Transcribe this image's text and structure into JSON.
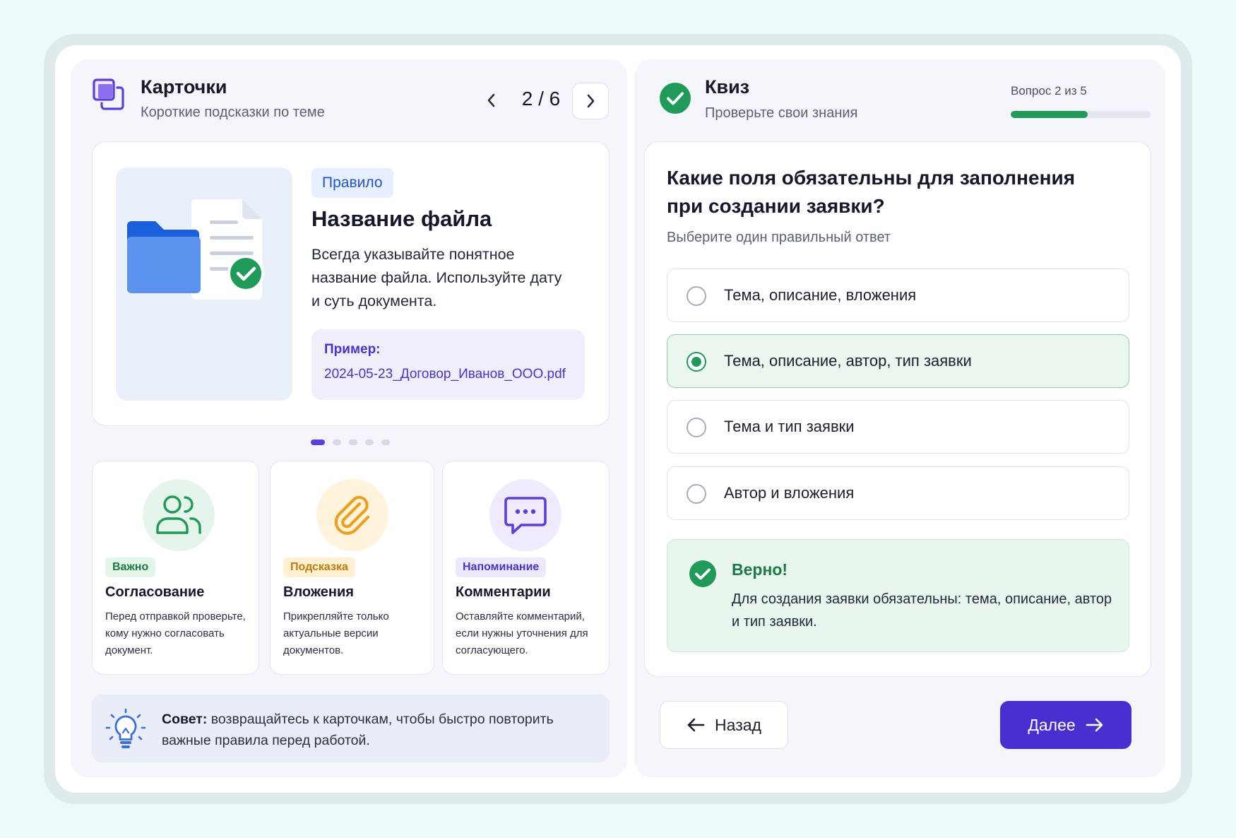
{
  "cards_panel": {
    "title": "Карточки",
    "subtitle": "Короткие подсказки по теме",
    "pager": "2 / 6"
  },
  "rule_card": {
    "badge": "Правило",
    "title": "Название файла",
    "text": "Всегда указывайте понятное название файла. Используйте дату и суть документа.",
    "example_label": "Пример:",
    "example_value": "2024-05-23_Договор_Иванов_ООО.pdf",
    "dots_total": 5,
    "dots_active": 1
  },
  "small_cards": [
    {
      "tag": "Важно",
      "title": "Согласование",
      "text": "Перед отправкой проверьте, кому нужно согласовать документ.",
      "icon": "users-icon"
    },
    {
      "tag": "Подсказка",
      "title": "Вложения",
      "text": "Прикрепляйте только актуальные версии документов.",
      "icon": "paperclip-icon"
    },
    {
      "tag": "Напоминание",
      "title": "Комментарии",
      "text": "Оставляйте комментарий, если нужны уточнения для согласующего.",
      "icon": "chat-icon"
    }
  ],
  "tip": {
    "label": "Совет:",
    "text": " возвращайтесь к карточкам, чтобы быстро повторить важные правила перед работой."
  },
  "quiz_panel": {
    "title": "Квиз",
    "subtitle": "Проверьте свои знания",
    "counter": "Вопрос 2 из 5",
    "progress_percent": 55
  },
  "quiz": {
    "question": "Какие поля обязательны для заполнения при создании заявки?",
    "hint": "Выберите один правильный ответ",
    "options": [
      {
        "label": "Тема, описание, вложения",
        "selected": false
      },
      {
        "label": "Тема, описание, автор, тип заявки",
        "selected": true
      },
      {
        "label": "Тема и тип заявки",
        "selected": false
      },
      {
        "label": "Автор и вложения",
        "selected": false
      }
    ],
    "feedback_title": "Верно!",
    "feedback_text": "Для создания заявки обязательны: тема, описание, автор и тип заявки."
  },
  "nav": {
    "back_label": "Назад",
    "next_label": "Далее"
  },
  "colors": {
    "accent": "#4a2fd0",
    "success": "#1f9a58",
    "info": "#2453c8"
  }
}
